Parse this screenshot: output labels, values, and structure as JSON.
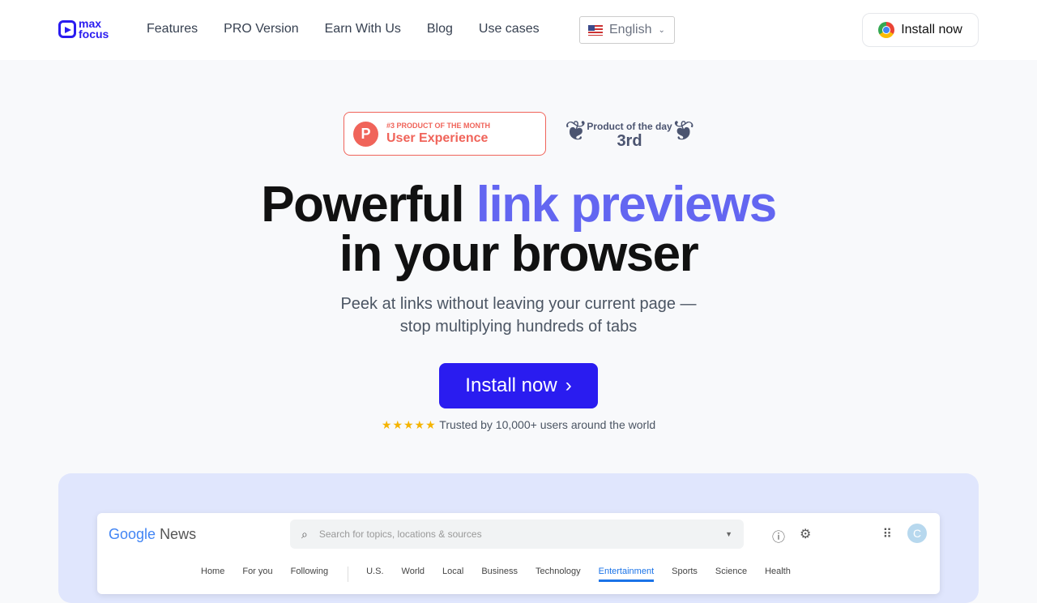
{
  "nav": {
    "logo_line1": "max",
    "logo_line2": "focus",
    "links": [
      "Features",
      "PRO Version",
      "Earn With Us",
      "Blog",
      "Use cases"
    ],
    "language": "English",
    "install": "Install now"
  },
  "badges": {
    "ph_small": "#3 PRODUCT OF THE MONTH",
    "ph_big": "User Experience",
    "ph_letter": "P",
    "pod_small": "Product of the day",
    "pod_big": "3rd"
  },
  "hero": {
    "title_a": "Powerful ",
    "title_accent": "link previews",
    "title_b": "in your browser",
    "sub1": "Peek at links without leaving your current page —",
    "sub2": "stop multiplying hundreds of tabs",
    "cta": "Install now",
    "stars": "★★★★★",
    "trust": "Trusted by 10,000+ users around the world"
  },
  "colors": {
    "brand": "#2a1cf0",
    "accent": "#6366f1",
    "ph": "#f0645a"
  },
  "demo": {
    "logo_google": "Google",
    "logo_news": "News",
    "search_placeholder": "Search for topics, locations & sources",
    "avatar": "C",
    "tabs": [
      "Home",
      "For you",
      "Following",
      "U.S.",
      "World",
      "Local",
      "Business",
      "Technology",
      "Entertainment",
      "Sports",
      "Science",
      "Health"
    ],
    "active_tab": "Entertainment"
  }
}
